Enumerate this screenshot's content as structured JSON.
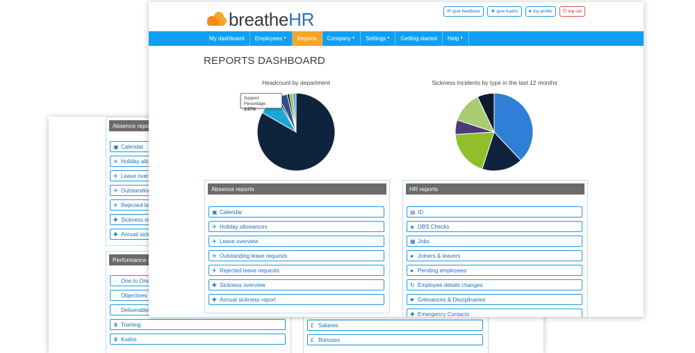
{
  "back_window": {
    "absence_panel": {
      "title": "Absence report",
      "items": [
        {
          "label": "Calendar",
          "icon": "calendar-icon"
        },
        {
          "label": "Holiday allow",
          "icon": "plane-icon"
        },
        {
          "label": "Leave overvie",
          "icon": "plane-icon"
        },
        {
          "label": "Outstanding",
          "icon": "plane-icon"
        },
        {
          "label": "Rejected lea",
          "icon": "plane-icon"
        },
        {
          "label": "Sickness ove",
          "icon": "medical-case-icon"
        },
        {
          "label": "Annual sick",
          "icon": "medical-case-icon"
        }
      ]
    },
    "performance_panel": {
      "title": "Performance re",
      "items": [
        {
          "label": "One to Ones",
          "icon": "speech-bubbles-icon"
        },
        {
          "label": "Objectives",
          "icon": "speech-bubbles-icon"
        },
        {
          "label": "Deliverables",
          "icon": "speech-bubbles-icon"
        },
        {
          "label": "Training",
          "icon": "trophy-icon"
        },
        {
          "label": "Kudos",
          "icon": "trophy-icon"
        }
      ]
    },
    "money_items": [
      {
        "label": "Salaries",
        "icon": "pound-icon"
      },
      {
        "label": "Bonuses",
        "icon": "pound-icon"
      }
    ]
  },
  "front_window": {
    "logo": {
      "word": "breathe",
      "accent": "HR"
    },
    "top_buttons": [
      {
        "label": "give feedback",
        "icon": "comment-icon"
      },
      {
        "label": "give kudos",
        "icon": "star-icon"
      },
      {
        "label": "my profile",
        "icon": "person-icon"
      },
      {
        "label": "log out",
        "icon": "power-icon"
      }
    ],
    "nav": [
      {
        "label": "My dashboard",
        "caret": false
      },
      {
        "label": "Employees",
        "caret": true
      },
      {
        "label": "Reports",
        "caret": false,
        "active": true
      },
      {
        "label": "Company",
        "caret": true
      },
      {
        "label": "Settings",
        "caret": true
      },
      {
        "label": "Getting started",
        "caret": false
      },
      {
        "label": "Help",
        "caret": true
      }
    ],
    "page_title": "REPORTS DASHBOARD",
    "tooltip": {
      "label": "Support",
      "key": "Percentage:",
      "value": "3.57%"
    },
    "absence_panel": {
      "title": "Absence reports",
      "items": [
        {
          "label": "Calendar",
          "icon": "calendar-icon"
        },
        {
          "label": "Holiday allowances",
          "icon": "plane-icon"
        },
        {
          "label": "Leave overview",
          "icon": "plane-icon"
        },
        {
          "label": "Outstanding leave requests",
          "icon": "plane-icon"
        },
        {
          "label": "Rejected leave requests",
          "icon": "plane-icon"
        },
        {
          "label": "Sickness overview",
          "icon": "medical-case-icon"
        },
        {
          "label": "Annual sickness report",
          "icon": "medical-case-icon"
        }
      ]
    },
    "hr_panel": {
      "title": "HR reports",
      "items": [
        {
          "label": "ID",
          "icon": "book-icon"
        },
        {
          "label": "DBS Checks",
          "icon": "shield-icon"
        },
        {
          "label": "Jobs",
          "icon": "briefcase-icon"
        },
        {
          "label": "Joiners & leavers",
          "icon": "person-icon"
        },
        {
          "label": "Pending employees",
          "icon": "person-icon"
        },
        {
          "label": "Employee details changes",
          "icon": "refresh-icon"
        },
        {
          "label": "Grievances & Disciplinaries",
          "icon": "hand-icon"
        },
        {
          "label": "Emergency Contacts",
          "icon": "medical-case-icon"
        }
      ]
    }
  },
  "chart_data": [
    {
      "type": "pie",
      "title": "Headcount by department",
      "slices": [
        {
          "value": 83.3,
          "color": "#10233c"
        },
        {
          "value": 8.4,
          "color": "#1ba7d4"
        },
        {
          "value": 1.0,
          "color": "#3d2e6b"
        },
        {
          "value": 3.57,
          "color": "#2f4f8f"
        },
        {
          "value": 1.0,
          "color": "#0e1a2e"
        },
        {
          "value": 1.3,
          "color": "#8fbf2a"
        },
        {
          "value": 1.43,
          "color": "#5fa8e8"
        }
      ]
    },
    {
      "type": "pie",
      "title": "Sickness incidents by type in the last 12 months",
      "slices": [
        {
          "value": 38,
          "color": "#2f7fd6"
        },
        {
          "value": 17,
          "color": "#10233c"
        },
        {
          "value": 19,
          "color": "#8fbf2a"
        },
        {
          "value": 6,
          "color": "#4b3a78"
        },
        {
          "value": 13,
          "color": "#a9cc72"
        },
        {
          "value": 7,
          "color": "#0e1a2e"
        }
      ]
    }
  ]
}
